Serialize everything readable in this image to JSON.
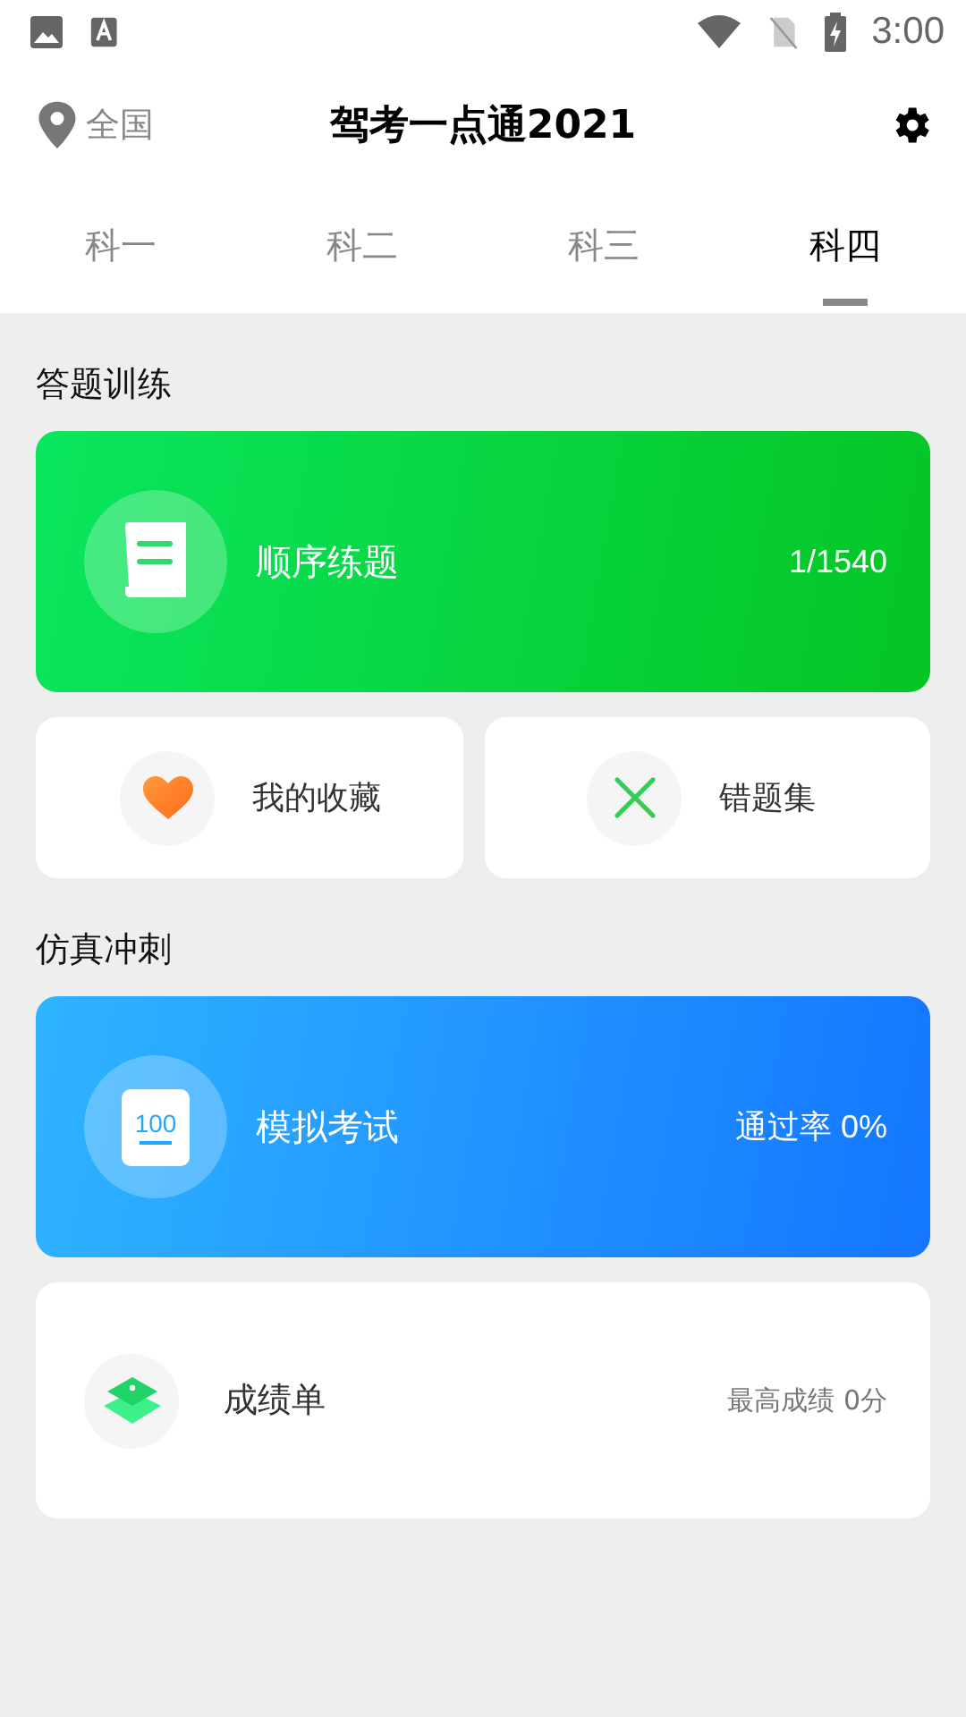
{
  "status_bar": {
    "time": "3:00"
  },
  "header": {
    "location": "全国",
    "title": "驾考一点通2021"
  },
  "tabs": [
    {
      "label": "科一",
      "selected": false
    },
    {
      "label": "科二",
      "selected": false
    },
    {
      "label": "科三",
      "selected": false
    },
    {
      "label": "科四",
      "selected": true
    }
  ],
  "sections": [
    {
      "title": "答题训练",
      "main_card": {
        "kind": "practice",
        "label": "顺序练题",
        "value": "1/1540"
      },
      "small_cards": [
        {
          "kind": "favorite",
          "label": "我的收藏"
        },
        {
          "kind": "mistakes",
          "label": "错题集"
        }
      ]
    },
    {
      "title": "仿真冲刺",
      "main_card": {
        "kind": "exam",
        "label": "模拟考试",
        "value": "通过率 0%",
        "icon_text": "100"
      },
      "row_card": {
        "label": "成绩单",
        "value": "最高成绩 0分"
      }
    }
  ]
}
